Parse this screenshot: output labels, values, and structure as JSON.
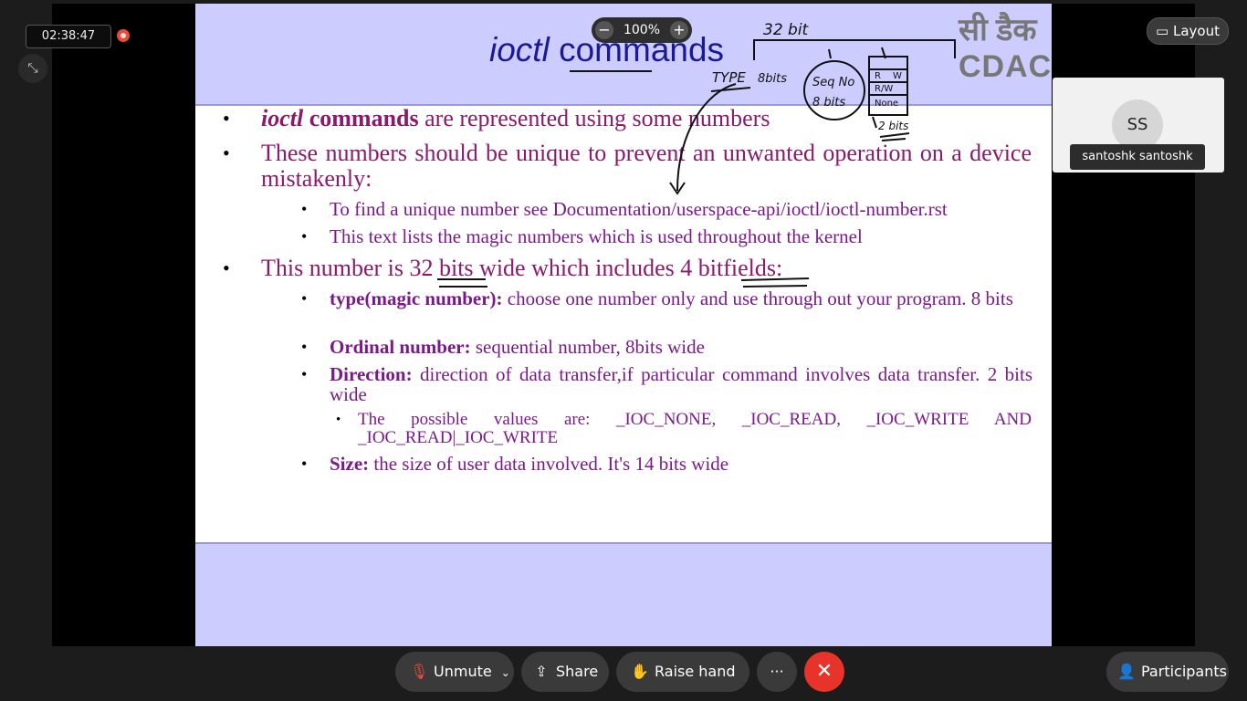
{
  "meeting": {
    "timer": "02:38:47",
    "zoom_level": "100%",
    "zoom_out_label": "−",
    "zoom_in_label": "+",
    "layout_label": "Layout",
    "participant_initials": "SS",
    "participant_name": "santoshk santoshk"
  },
  "toolbar": {
    "unmute_label": "Unmute",
    "share_label": "Share",
    "raise_hand_label": "Raise hand",
    "more_label": "···",
    "participants_label": "Participants"
  },
  "slide": {
    "title_italic": "ioctl",
    "title_rest": " commands",
    "logo_hindi": "सी डैक",
    "logo_text": "CDAC",
    "b1_italic": "ioctl",
    "b1_bold": " commands",
    "b1_rest": " are represented using some numbers",
    "b2": "These numbers should be unique to prevent an unwanted operation on a device mistakenly:",
    "b2_1": "To find a unique number see Documentation/userspace-api/ioctl/ioctl-number.rst",
    "b2_2": "This text lists the magic numbers which is used throughout the kernel",
    "b3": "This number is 32 bits wide which includes 4 bitfields:",
    "b3_1_bold": "type(magic number):",
    "b3_1_rest": " choose one number only and use through out your program. 8 bits",
    "b3_2_bold": "Ordinal number:",
    "b3_2_rest": " sequential number, 8bits wide",
    "b3_3_bold": "Direction:",
    "b3_3_rest": " direction of data transfer,if particular command involves data transfer. 2 bits wide",
    "b3_3_1": "The possible values are: _IOC_NONE, _IOC_READ, _IOC_WRITE AND _IOC_READ|_IOC_WRITE",
    "b3_4_bold": "Size:",
    "b3_4_rest": " the size of user data involved. It's 14 bits wide"
  },
  "annotations": {
    "a1": "32 bit",
    "a2": "TYPE",
    "a3": "8bits",
    "a4": "Seq No",
    "a5": "8 bits",
    "a6": "R",
    "a7": "W",
    "a8": "R/W",
    "a9": "None",
    "a10": "2 bits",
    "ink_color": "#111111"
  },
  "colors": {
    "slide_band": "#ccccff",
    "title_color": "#1a1a99",
    "text_color": "#8a1a6a",
    "end_call": "#e8332a",
    "record": "#e84b3a"
  }
}
